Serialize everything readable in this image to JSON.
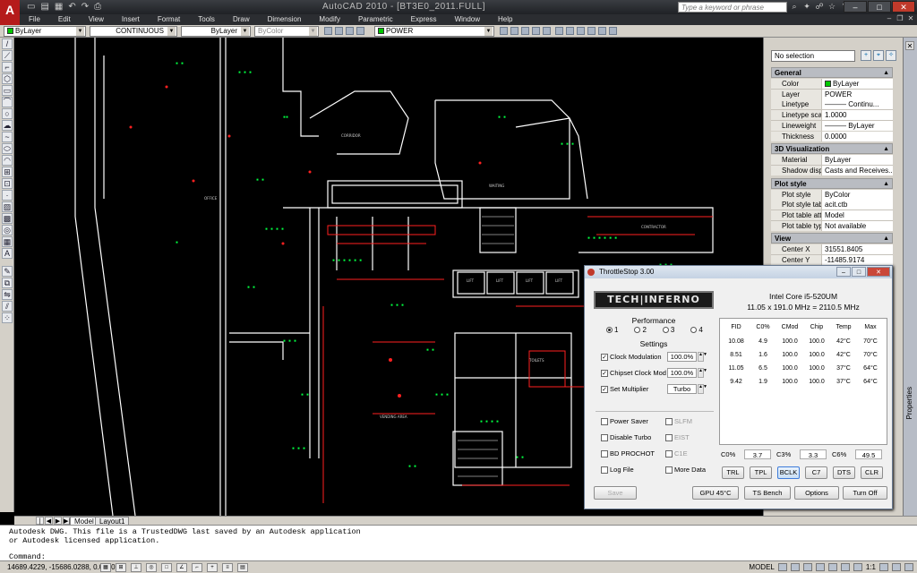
{
  "app": {
    "title": "AutoCAD 2010 - [BT3E0_2011.FULL]",
    "logo": "A",
    "search_placeholder": "Type a keyword or phrase",
    "qa_icons": [
      "new",
      "open",
      "save",
      "undo",
      "redo",
      "plot"
    ]
  },
  "menubar": [
    "File",
    "Edit",
    "View",
    "Insert",
    "Format",
    "Tools",
    "Draw",
    "Dimension",
    "Modify",
    "Parametric",
    "Express",
    "Window",
    "Help"
  ],
  "prop_toolbar": {
    "color": "ByLayer",
    "linetype": "CONTINUOUS",
    "lineweight": "ByLayer",
    "plotstyle": "ByColor",
    "layer": "POWER"
  },
  "layout_tabs": [
    "Model",
    "Layout1"
  ],
  "command": {
    "line1": "Autodesk DWG.  This file is a TrustedDWG last saved by an Autodesk application",
    "line2": "or Autodesk licensed application.",
    "prompt": "Command:"
  },
  "status": {
    "coords": "14689.4229, -15686.0288, 0.0000",
    "mode": "MODEL",
    "scale": "1:1"
  },
  "palette": {
    "selection": "No selection",
    "tab_label": "Properties",
    "sections": [
      {
        "title": "General",
        "rows": [
          [
            "Color",
            "ByLayer"
          ],
          [
            "Layer",
            "POWER"
          ],
          [
            "Linetype",
            "——— Continu..."
          ],
          [
            "Linetype scale",
            "1.0000"
          ],
          [
            "Lineweight",
            "——— ByLayer"
          ],
          [
            "Thickness",
            "0.0000"
          ]
        ]
      },
      {
        "title": "3D Visualization",
        "rows": [
          [
            "Material",
            "ByLayer"
          ],
          [
            "Shadow display",
            "Casts and Receives..."
          ]
        ]
      },
      {
        "title": "Plot style",
        "rows": [
          [
            "Plot style",
            "ByColor"
          ],
          [
            "Plot style table",
            "acit.ctb"
          ],
          [
            "Plot table attac...",
            "Model"
          ],
          [
            "Plot table type",
            "Not available"
          ]
        ]
      },
      {
        "title": "View",
        "rows": [
          [
            "Center X",
            "31551.8405"
          ],
          [
            "Center Y",
            "-11485.9174"
          ]
        ]
      }
    ]
  },
  "throttlestop": {
    "title": "ThrottleStop 3.00",
    "logo": "TECH|INFERNO",
    "cpu_name": "Intel Core i5-520UM",
    "cpu_freq": "11.05 x 191.0 MHz = 2110.5 MHz",
    "performance_label": "Performance",
    "radios": [
      "1",
      "2",
      "3",
      "4"
    ],
    "settings_label": "Settings",
    "settings": [
      {
        "label": "Clock Modulation",
        "checked": true,
        "value": "100.0%"
      },
      {
        "label": "Chipset Clock Mod",
        "checked": true,
        "value": "100.0%"
      },
      {
        "label": "Set Multiplier",
        "checked": true,
        "value": "Turbo"
      }
    ],
    "options": [
      {
        "label": "Power Saver",
        "checked": false,
        "side": "SLFM",
        "side_checked": false
      },
      {
        "label": "Disable Turbo",
        "checked": false,
        "side": "EIST",
        "side_checked": false
      },
      {
        "label": "BD PROCHOT",
        "checked": false,
        "side": "C1E",
        "side_checked": false
      },
      {
        "label": "Log File",
        "checked": false,
        "side": "More Data",
        "side_checked": false
      }
    ],
    "table_headers": [
      "FID",
      "C0%",
      "CMod",
      "Chip",
      "Temp",
      "Max"
    ],
    "table_rows": [
      [
        "10.08",
        "4.9",
        "100.0",
        "100.0",
        "42°C",
        "70°C"
      ],
      [
        "8.51",
        "1.6",
        "100.0",
        "100.0",
        "42°C",
        "70°C"
      ],
      [
        "11.05",
        "6.5",
        "100.0",
        "100.0",
        "37°C",
        "64°C"
      ],
      [
        "9.42",
        "1.9",
        "100.0",
        "100.0",
        "37°C",
        "64°C"
      ]
    ],
    "summary": [
      {
        "label": "C0%",
        "value": "3.7"
      },
      {
        "label": "C3%",
        "value": "3.3"
      },
      {
        "label": "C6%",
        "value": "49.5"
      }
    ],
    "small_buttons": [
      "TRL",
      "TPL",
      "BCLK",
      "C7",
      "DTS",
      "CLR"
    ],
    "save_label": "Save",
    "gpu_label": "GPU 45°C",
    "ts_bench_label": "TS Bench",
    "options_label": "Options",
    "turn_off_label": "Turn Off"
  },
  "drawing_labels": [
    "OFFICE",
    "CONTRACTOR",
    "VENDING AREA",
    "CORRIDOR",
    "WAITING",
    "TOILETS",
    "LIFT",
    "LIFT",
    "LIFT",
    "LIFT",
    "LIFT"
  ]
}
